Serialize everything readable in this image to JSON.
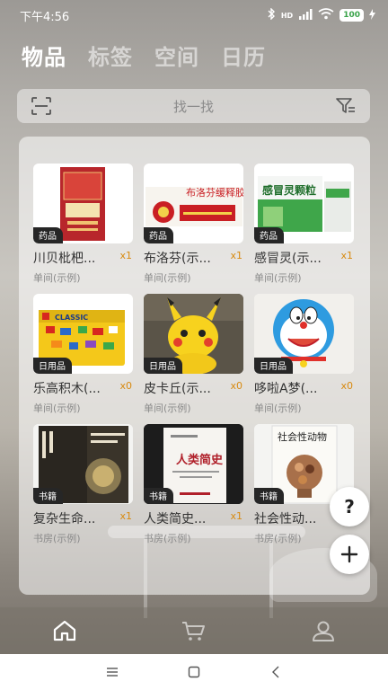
{
  "status_bar": {
    "time": "下午4:56",
    "signal": "HD",
    "battery": "100"
  },
  "top_tabs": [
    {
      "label": "物品",
      "active": true
    },
    {
      "label": "标签",
      "active": false
    },
    {
      "label": "空间",
      "active": false
    },
    {
      "label": "日历",
      "active": false
    }
  ],
  "search": {
    "placeholder": "找一找"
  },
  "items": [
    {
      "name": "川贝枇杷...",
      "category": "药品",
      "count": "x1",
      "location": "单间(示例)",
      "icon": "cough-syrup-box"
    },
    {
      "name": "布洛芬(示...",
      "category": "药品",
      "count": "x1",
      "location": "单间(示例)",
      "icon": "ibuprofen-box",
      "box_text": "布洛芬缓释胶囊"
    },
    {
      "name": "感冒灵(示...",
      "category": "药品",
      "count": "x1",
      "location": "单间(示例)",
      "icon": "cold-medicine-box",
      "box_text": "感冒灵颗粒"
    },
    {
      "name": "乐高积木(...",
      "category": "日用品",
      "count": "x0",
      "location": "单间(示例)",
      "icon": "lego-box",
      "box_text": "CLASSIC"
    },
    {
      "name": "皮卡丘(示...",
      "category": "日用品",
      "count": "x0",
      "location": "单间(示例)",
      "icon": "pikachu-plush"
    },
    {
      "name": "哆啦A梦(...",
      "category": "日用品",
      "count": "x0",
      "location": "单间(示例)",
      "icon": "doraemon-plush"
    },
    {
      "name": "复杂生命...",
      "category": "书籍",
      "count": "x1",
      "location": "书房(示例)",
      "icon": "book-vital-question"
    },
    {
      "name": "人类简史...",
      "category": "书籍",
      "count": "x1",
      "location": "书房(示例)",
      "icon": "book-sapiens",
      "box_text": "人类简史"
    },
    {
      "name": "社会性动...",
      "category": "书籍",
      "count": "x1",
      "location": "书房(示例)",
      "icon": "book-social-animal",
      "box_text": "社会性动物"
    }
  ],
  "fab": {
    "help_label": "?"
  },
  "bottom_nav": [
    {
      "icon": "home-icon",
      "active": true
    },
    {
      "icon": "cart-icon",
      "active": false
    },
    {
      "icon": "profile-icon",
      "active": false
    }
  ]
}
